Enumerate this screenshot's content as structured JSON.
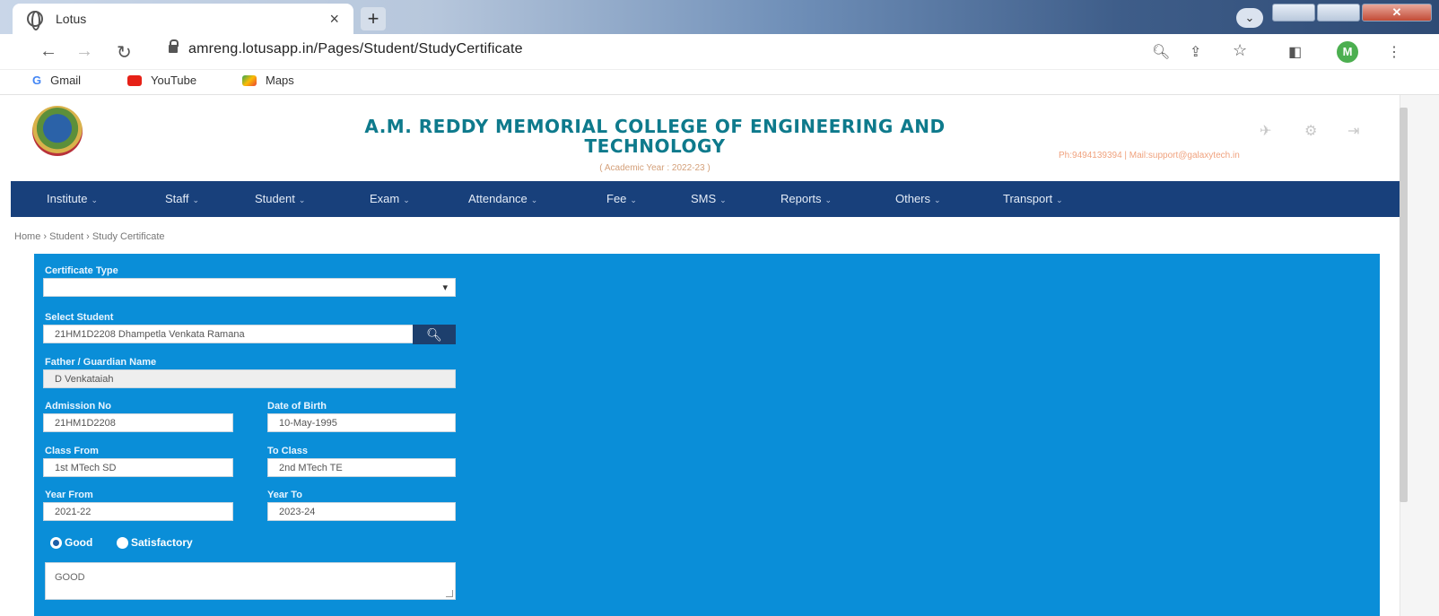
{
  "browser": {
    "tab_title": "Lotus",
    "tab_close": "×",
    "new_tab": "+",
    "tab_dropdown": "⌄",
    "url": "amreng.lotusapp.in/Pages/Student/StudyCertificate",
    "profile_initial": "M",
    "bookmarks": [
      "Gmail",
      "YouTube",
      "Maps"
    ]
  },
  "college": {
    "name_line1": "A.M. REDDY MEMORIAL COLLEGE OF ENGINEERING AND",
    "name_line2": "TECHNOLOGY",
    "academic_year": "( Academic Year : 2022-23 )",
    "contact": "Ph:9494139394 | Mail:support@galaxytech.in"
  },
  "menu": [
    "Institute",
    "Staff",
    "Student",
    "Exam",
    "Attendance",
    "Fee",
    "SMS",
    "Reports",
    "Others",
    "Transport"
  ],
  "breadcrumb": "Home › Student › Study Certificate",
  "form": {
    "certificate_type_label": "Certificate Type",
    "certificate_type_value": "",
    "select_student_label": "Select Student",
    "select_student_value": "21HM1D2208  Dhampetla Venkata Ramana",
    "father_label": "Father / Guardian Name",
    "father_value": "D Venkataiah",
    "admission_label": "Admission No",
    "admission_value": "21HM1D2208",
    "dob_label": "Date of Birth",
    "dob_value": "10-May-1995",
    "class_from_label": "Class From",
    "class_from_value": "1st MTech SD",
    "to_class_label": "To Class",
    "to_class_value": "2nd MTech TE",
    "year_from_label": "Year From",
    "year_from_value": "2021-22",
    "year_to_label": "Year To",
    "year_to_value": "2023-24",
    "conduct_options": [
      "Good",
      "Satisfactory"
    ],
    "conduct_selected": "Good",
    "remarks_value": "GOOD"
  },
  "colors": {
    "menu_bg": "#18407b",
    "panel_bg": "#0a8ed8",
    "title": "#0e7a8c"
  }
}
